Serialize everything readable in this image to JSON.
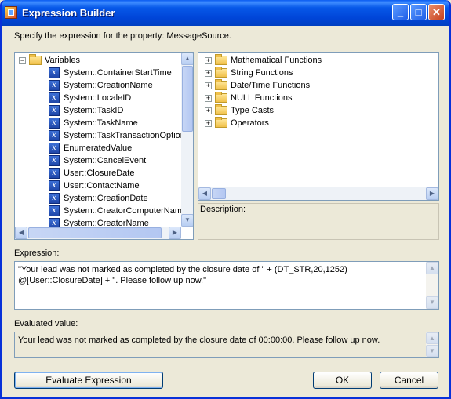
{
  "window": {
    "title": "Expression Builder"
  },
  "prompt": "Specify the expression for the property: MessageSource.",
  "variables_tree": {
    "root_label": "Variables",
    "items": [
      "System::ContainerStartTime",
      "System::CreationName",
      "System::LocaleID",
      "System::TaskID",
      "System::TaskName",
      "System::TaskTransactionOption",
      "EnumeratedValue",
      "System::CancelEvent",
      "User::ClosureDate",
      "User::ContactName",
      "System::CreationDate",
      "System::CreatorComputerName",
      "System::CreatorName"
    ]
  },
  "functions_tree": {
    "items": [
      "Mathematical Functions",
      "String Functions",
      "Date/Time Functions",
      "NULL Functions",
      "Type Casts",
      "Operators"
    ]
  },
  "description_label": "Description:",
  "expression": {
    "label": "Expression:",
    "value": "\"Your lead was not marked as completed by the closure date of \" + (DT_STR,20,1252) @[User::ClosureDate] + \".  Please follow up now.\""
  },
  "evaluated": {
    "label": "Evaluated value:",
    "value": "Your lead was not marked as completed by the closure date of 00:00:00.  Please follow up now."
  },
  "buttons": {
    "evaluate": "Evaluate Expression",
    "ok": "OK",
    "cancel": "Cancel"
  }
}
